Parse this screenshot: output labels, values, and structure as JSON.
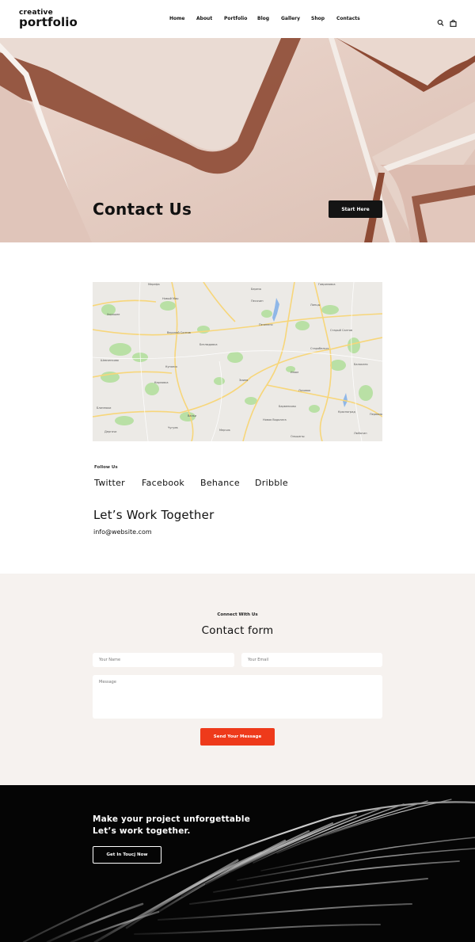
{
  "header": {
    "logo_line1": "creative",
    "logo_line2": "portfolio",
    "nav": [
      "Home",
      "About",
      "Portfolio",
      "Blog",
      "Gallery",
      "Shop",
      "Contacts"
    ],
    "icons": [
      "search-icon",
      "shopping-bag-icon"
    ]
  },
  "hero": {
    "title": "Contact Us",
    "button": "Start Here"
  },
  "map": {
    "labels": [
      "Мерефа",
      "Береза",
      "Гавриловка",
      "Новый Мир",
      "Хорошее",
      "Песочин",
      "Липцы",
      "Верхний Салтов",
      "Печенеги",
      "Старый Салтов",
      "Безлюдовка",
      "Шевченково",
      "Старобельск",
      "Изюм",
      "Балаклея",
      "Купянск",
      "Змиев",
      "Карловка",
      "Лозовая",
      "Близнюки",
      "Барвенково",
      "Красноград",
      "Валки",
      "Новая Водолага",
      "Первомайский",
      "Чугуев",
      "Мерчик",
      "Ольшаны",
      "Дергачи",
      "Люботин"
    ]
  },
  "follow": {
    "label": "Follow Us",
    "links": [
      "Twitter",
      "Facebook",
      "Behance",
      "Dribble"
    ]
  },
  "work": {
    "title": "Let’s Work Together",
    "email": "info@website.com"
  },
  "contact": {
    "subtitle": "Connect With Us",
    "title": "Contact form",
    "name_placeholder": "Your Name",
    "email_placeholder": "Your Email",
    "message_placeholder": "Message",
    "submit": "Send Your Message"
  },
  "footer": {
    "line1": "Make your project unforgettable",
    "line2": "Let’s work together.",
    "button": "Get In Toucj Now"
  },
  "colors": {
    "accent": "#ee3a1b",
    "dark": "#141414",
    "hero_bg": "#e4cbc1",
    "section_bg": "#f6f2ef"
  }
}
